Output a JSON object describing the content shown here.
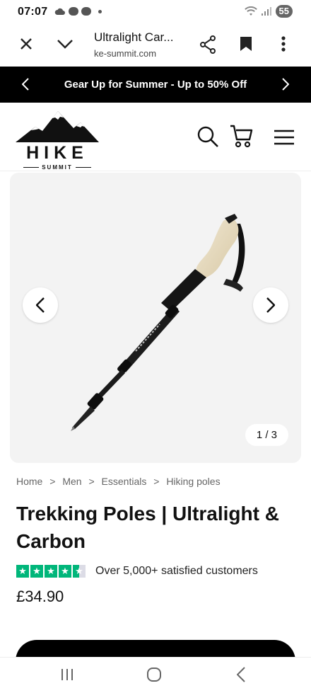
{
  "status_bar": {
    "time": "07:07",
    "battery": "55"
  },
  "browser": {
    "title": "Ultralight Car...",
    "url": "ke-summit.com"
  },
  "promo": {
    "text": "Gear Up for Summer - Up to 50% Off"
  },
  "logo": {
    "name": "HIKE",
    "sub": "SUMMIT"
  },
  "gallery": {
    "counter": "1 / 3"
  },
  "breadcrumb": [
    "Home",
    ">",
    "Men",
    ">",
    "Essentials",
    ">",
    "Hiking poles"
  ],
  "product": {
    "title": "Trekking Poles | Ultralight & Carbon",
    "rating_text": "Over 5,000+ satisfied customers",
    "price": "£34.90",
    "rating_stars": 4.5
  },
  "colors": {
    "accent": "#000000",
    "trustpilot_green": "#00b67a"
  }
}
